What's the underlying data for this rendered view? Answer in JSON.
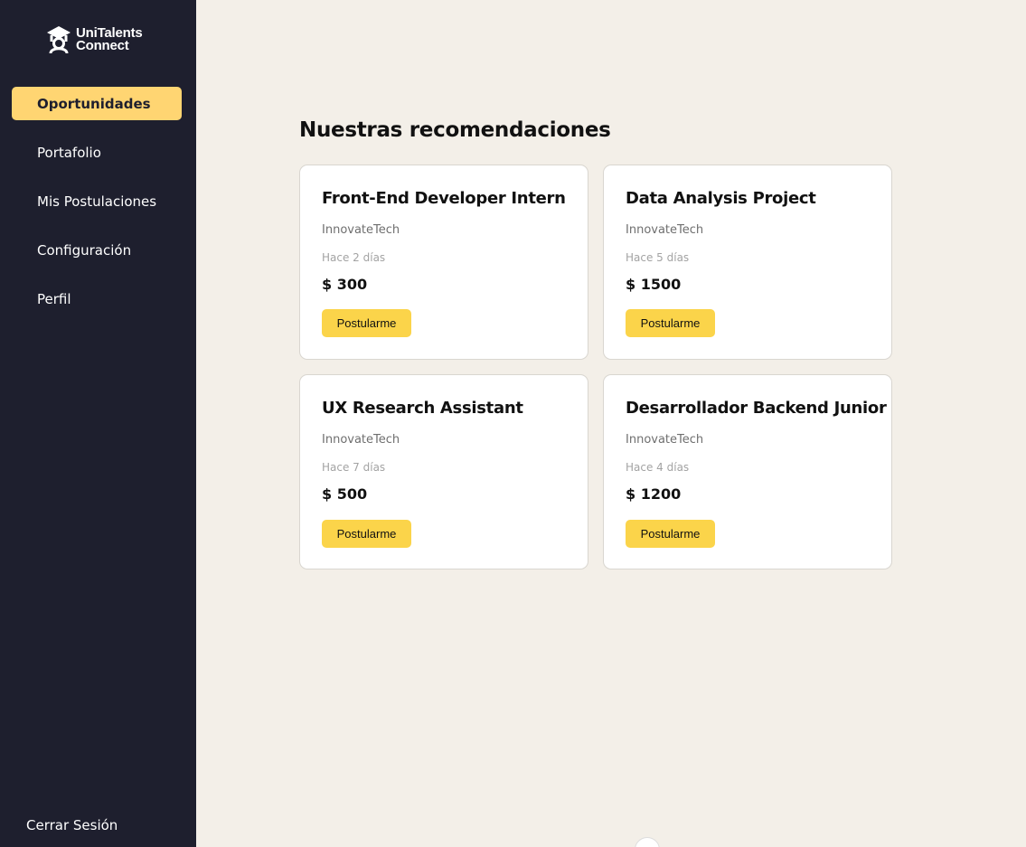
{
  "brand": {
    "line1": "UniTalents",
    "line2": "Connect",
    "icon": "graduate-icon"
  },
  "sidebar": {
    "items": [
      {
        "label": "Oportunidades",
        "active": true
      },
      {
        "label": "Portafolio",
        "active": false
      },
      {
        "label": "Mis Postulaciones",
        "active": false
      },
      {
        "label": "Configuración",
        "active": false
      },
      {
        "label": "Perfil",
        "active": false
      }
    ],
    "logout_label": "Cerrar Sesión"
  },
  "main": {
    "heading": "Nuestras recomendaciones",
    "cards": [
      {
        "title": "Front-End Developer Intern",
        "company": "InnovateTech",
        "posted": "Hace 2 días",
        "price": "$ 300",
        "button": "Postularme"
      },
      {
        "title": "Data Analysis Project",
        "company": "InnovateTech",
        "posted": "Hace 5 días",
        "price": "$ 1500",
        "button": "Postularme"
      },
      {
        "title": "UX Research Assistant",
        "company": "InnovateTech",
        "posted": "Hace 7 días",
        "price": "$ 500",
        "button": "Postularme"
      },
      {
        "title": "Desarrollador Backend Junior",
        "company": "InnovateTech",
        "posted": "Hace 4 días",
        "price": "$ 1200",
        "button": "Postularme"
      }
    ]
  },
  "colors": {
    "sidebar_bg": "#1e1f2e",
    "active_item": "#ffd572",
    "page_bg": "#f3efe8",
    "button": "#fbd44a"
  }
}
